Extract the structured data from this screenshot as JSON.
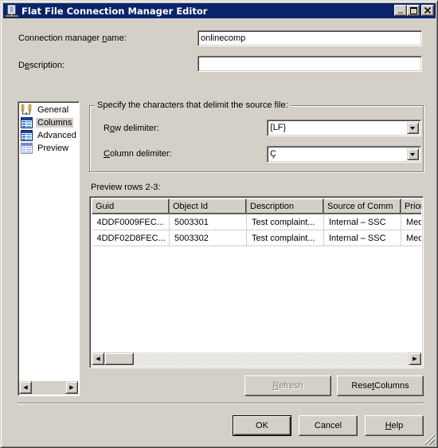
{
  "window": {
    "title": "Flat File Connection Manager Editor",
    "controls": {
      "minimize": "_",
      "maximize": "□",
      "close": "×"
    }
  },
  "form": {
    "name_label_pre": "Connection manager ",
    "name_label_ul": "n",
    "name_label_post": "ame:",
    "name_value": "onlinecomp",
    "desc_label_pre": "D",
    "desc_label_ul": "e",
    "desc_label_post": "scription:",
    "desc_value": ""
  },
  "nav": {
    "items": [
      {
        "label": "General",
        "icon": "general-icon",
        "selected": false
      },
      {
        "label": "Columns",
        "icon": "columns-icon",
        "selected": true
      },
      {
        "label": "Advanced",
        "icon": "advanced-icon",
        "selected": false
      },
      {
        "label": "Preview",
        "icon": "preview-icon",
        "selected": false
      }
    ]
  },
  "delimiters": {
    "group_title": "Specify the characters that delimit the source file:",
    "row_label_pre": "R",
    "row_label_ul": "o",
    "row_label_post": "w delimiter:",
    "row_value": "{LF}",
    "col_label_ul": "C",
    "col_label_post": "olumn delimiter:",
    "col_value": "Ç"
  },
  "preview": {
    "label": "Preview rows 2-3:",
    "columns": [
      "Guid",
      "Object Id",
      "Description",
      "Source of Comm",
      "Priori"
    ],
    "rows": [
      [
        "4DDF0009FEC...",
        "5003301",
        "Test complaint...",
        "Internal – SSC",
        "Medi"
      ],
      [
        "4DDF02D8FEC...",
        "5003302",
        "Test complaint...",
        "Internal – SSC",
        "Medi"
      ]
    ]
  },
  "buttons": {
    "refresh_ul": "R",
    "refresh_post": "efresh",
    "reset_pre": "Rese",
    "reset_ul": "t",
    "reset_post": " Columns",
    "ok": "OK",
    "cancel": "Cancel",
    "help_ul": "H",
    "help_post": "elp"
  }
}
